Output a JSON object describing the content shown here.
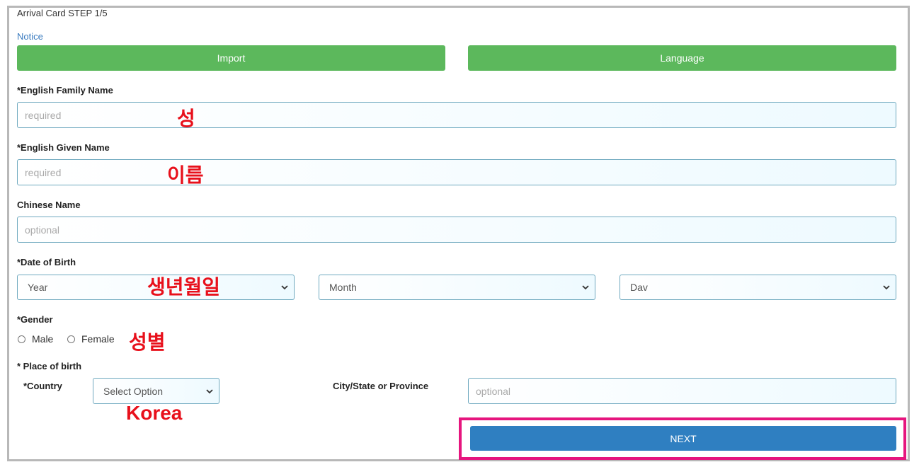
{
  "header": {
    "step_title": "Arrival Card STEP 1/5",
    "notice_link": "Notice"
  },
  "buttons": {
    "import": "Import",
    "language": "Language",
    "next": "NEXT"
  },
  "fields": {
    "family_name": {
      "label": "*English Family Name",
      "placeholder": "required",
      "annotation": "성"
    },
    "given_name": {
      "label": "*English Given Name",
      "placeholder": "required",
      "annotation": "이름"
    },
    "chinese_name": {
      "label": "Chinese Name",
      "placeholder": "optional"
    },
    "dob": {
      "label": "*Date of Birth",
      "year": "Year",
      "month": "Month",
      "day": "Dav",
      "annotation": "생년월일"
    },
    "gender": {
      "label": "*Gender",
      "male": "Male",
      "female": "Female",
      "annotation": "성별"
    },
    "place_of_birth": {
      "label": "* Place of birth",
      "country_label": "*Country",
      "country_value": "Select Option",
      "country_annotation": "Korea",
      "city_label": "City/State or Province",
      "city_placeholder": "optional"
    }
  },
  "colors": {
    "green_button": "#5cb85c",
    "next_button": "#2f7fc1",
    "highlight": "#e6157e",
    "annotation": "#e8101b"
  }
}
